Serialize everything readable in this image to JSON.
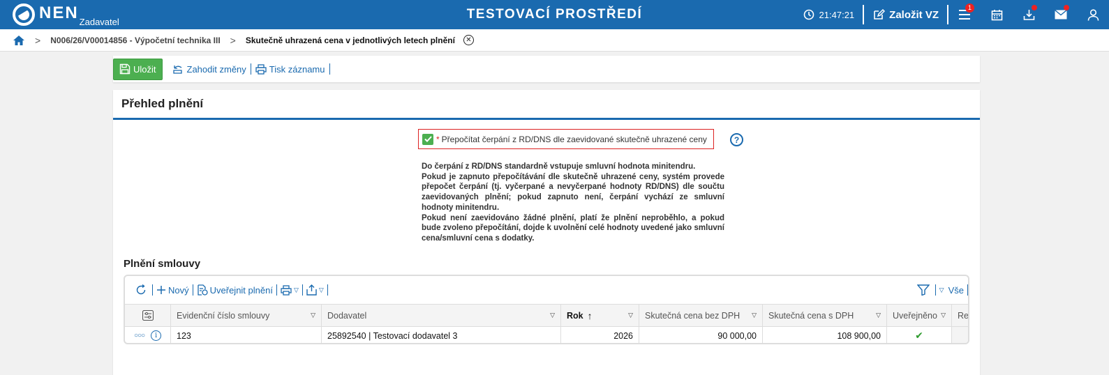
{
  "topbar": {
    "logo_text": "NEN",
    "logo_sub": "Zadavatel",
    "title": "TESTOVACÍ PROSTŘEDÍ",
    "time": "21:47:21",
    "create_label": "Založit VZ",
    "menu_badge": "1",
    "icons": [
      "clock-icon",
      "edit-icon",
      "menu-icon",
      "calendar-icon",
      "download-icon",
      "mail-icon",
      "user-icon"
    ]
  },
  "breadcrumb": {
    "item1": "N006/26/V00014856 - Výpočetní technika III",
    "current": "Skutečně uhrazená cena v jednotlivých letech plnění"
  },
  "toolbar": {
    "save_label": "Uložit",
    "discard_label": "Zahodit změny",
    "print_label": "Tisk záznamu"
  },
  "panel": {
    "title": "Přehled plnění",
    "checkbox_label": "Přepočítat čerpání z RD/DNS dle zaevidované skutečně uhrazené ceny",
    "checkbox_checked": true,
    "required_mark": "*",
    "help_label": "?",
    "info_lines": [
      "Do čerpání z RD/DNS standardně vstupuje smluvní hodnota minitendru.",
      "Pokud je zapnuto přepočítávání dle skutečně uhrazené ceny, systém provede přepočet čerpání (tj. vyčerpané a nevyčerpané hodnoty RD/DNS) dle součtu zaevidovaných plnění; pokud zapnuto není, čerpání vychází ze smluvní hodnoty minitendru.",
      "Pokud není zaevidováno žádné plnění, platí že plnění neproběhlo, a pokud bude zvoleno přepočítání, dojde k uvolnění celé hodnoty uvedené jako smluvní cena/smluvní cena s dodatky."
    ]
  },
  "grid": {
    "title": "Plnění smlouvy",
    "tools": {
      "new_label": "Nový",
      "publish_label": "Uveřejnit plnění",
      "all_label": "Vše"
    },
    "columns": [
      "Evidenční číslo smlouvy",
      "Dodavatel",
      "Rok",
      "Skutečná cena bez DPH",
      "Skutečná cena s DPH",
      "Uveřejněno",
      "Re"
    ],
    "rows": [
      {
        "contract_no": "123",
        "supplier": "25892540 | Testovací dodavatel 3",
        "year": "2026",
        "price_excl": "90 000,00",
        "price_incl": "108 900,00",
        "published": "✔"
      }
    ]
  }
}
